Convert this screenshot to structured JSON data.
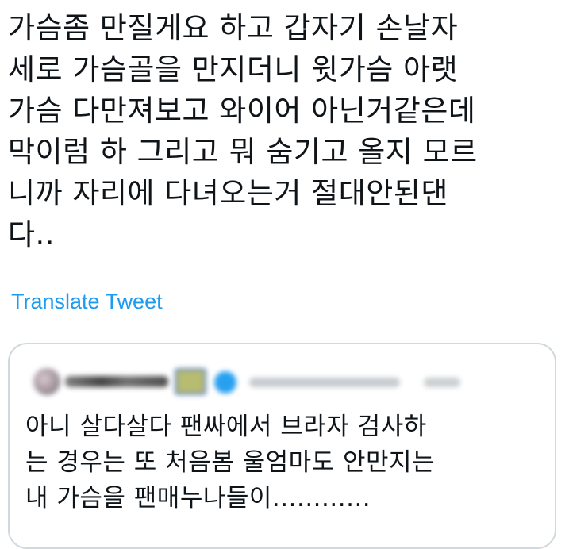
{
  "tweet": {
    "text_lines": [
      "가슴좀 만질게요 하고 갑자기 손날자",
      "세로 가슴골을 만지더니 윗가슴 아랫",
      "가슴 다만져보고 와이어 아닌거같은데",
      "막이럼 하 그리고 뭐 숨기고 올지 모르",
      "니까 자리에 다녀오는거 절대안된댄",
      "다.."
    ],
    "translate_label": "Translate Tweet"
  },
  "quoted_tweet": {
    "text_lines": [
      "아니 살다살다 팬싸에서 브라자 검사하",
      "는 경우는 또 처음봄 울엄마도 안만지는",
      "내 가슴을 팬매누나들이............"
    ]
  },
  "colors": {
    "link": "#1d9bf0",
    "text": "#0f1419",
    "border": "#cfd9de"
  }
}
